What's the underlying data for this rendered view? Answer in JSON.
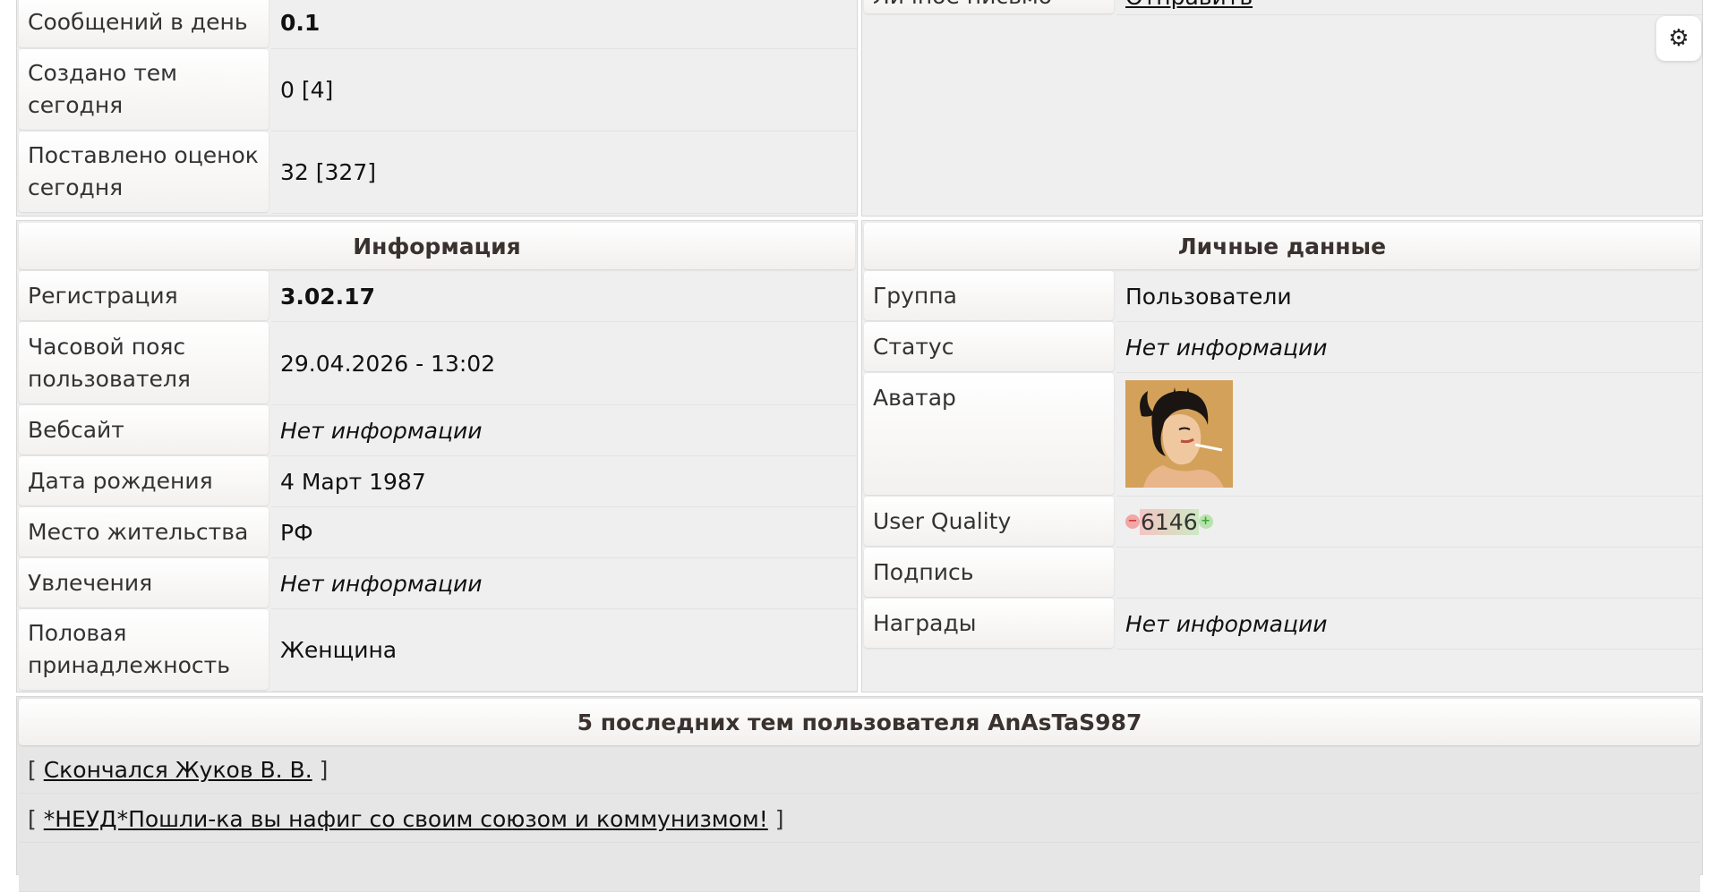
{
  "stats": {
    "rows": [
      {
        "label": "Сообщений в день",
        "value": "0.1"
      },
      {
        "label": "Создано тем сегодня",
        "value": "0 [4]"
      },
      {
        "label": "Поставлено оценок сегодня",
        "value": "32 [327]"
      }
    ]
  },
  "contact": {
    "partial_label": "Личное письмо",
    "partial_value": "Отправить"
  },
  "info": {
    "title": "Информация",
    "rows": [
      {
        "label": "Регистрация",
        "value": "3.02.17"
      },
      {
        "label": "Часовой пояс пользователя",
        "value": "29.04.2026 - 13:02"
      },
      {
        "label": "Вебсайт",
        "value": "Нет информации"
      },
      {
        "label": "Дата рождения",
        "value": "4 Март 1987"
      },
      {
        "label": "Место жительства",
        "value": "РФ"
      },
      {
        "label": "Увлечения",
        "value": "Нет информации"
      },
      {
        "label": "Половая принадлежность",
        "value": "Женщина"
      }
    ]
  },
  "personal": {
    "title": "Личные данные",
    "rows": [
      {
        "label": "Группа",
        "value": "Пользователи"
      },
      {
        "label": "Статус",
        "value": "Нет информации"
      },
      {
        "label": "Аватар",
        "value": ""
      },
      {
        "label": "User Quality",
        "value": "6146"
      },
      {
        "label": "Подпись",
        "value": ""
      },
      {
        "label": "Награды",
        "value": "Нет информации"
      }
    ],
    "uq_minus": "−",
    "uq_plus": "+"
  },
  "topics": {
    "title": "5 последних тем пользователя AnAsTaS987",
    "bracket_open": "[",
    "bracket_close": "]",
    "items": [
      {
        "title": "Скончался Жуков В. В."
      },
      {
        "title": "*НЕУД*Пошли-ка вы нафиг со своим союзом и коммунизмом!"
      }
    ]
  },
  "icons": {
    "settings": "⚙"
  }
}
